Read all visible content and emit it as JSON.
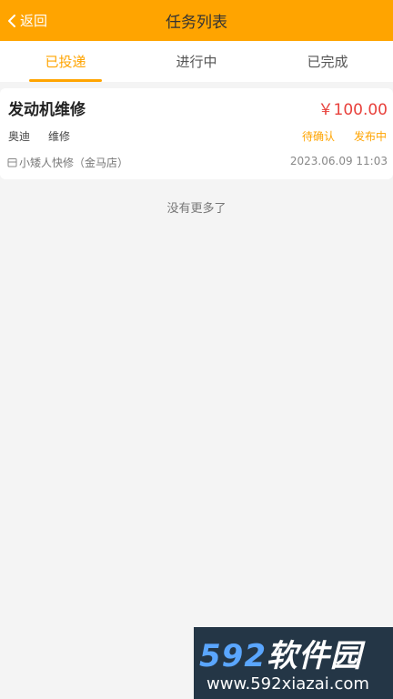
{
  "header": {
    "back_label": "返回",
    "back_icon": "chevron-left-icon",
    "title": "任务列表"
  },
  "tabs": [
    {
      "label": "已投递",
      "active": true
    },
    {
      "label": "进行中",
      "active": false
    },
    {
      "label": "已完成",
      "active": false
    }
  ],
  "tasks": [
    {
      "name": "发动机维修",
      "price": "￥100.00",
      "brand": "奥迪",
      "service": "维修",
      "status": "待确认",
      "action": "发布中",
      "shop_icon": "shop-icon",
      "shop": "小矮人快修（金马店）",
      "time": "2023.06.09 11:03"
    }
  ],
  "list": {
    "no_more": "没有更多了"
  },
  "watermark": {
    "brand_num": "592",
    "brand_name": "软件园",
    "url": "www.592xiazai.com"
  },
  "colors": {
    "accent": "#ffa400",
    "price": "#e8413c",
    "background": "#f4f4f4"
  }
}
